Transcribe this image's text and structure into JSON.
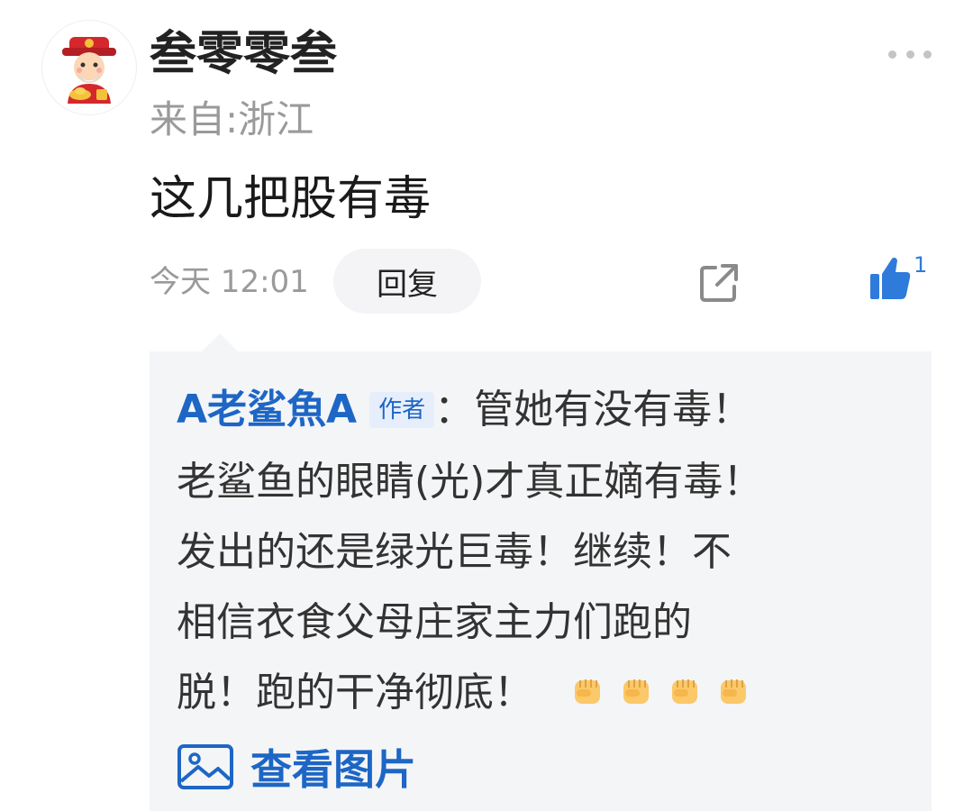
{
  "comment": {
    "username": "叁零零叁",
    "location": "来自:浙江",
    "text": "这几把股有毒",
    "time": "今天 12:01",
    "reply_label": "回复",
    "like_count": "1",
    "icons": {
      "avatar": "god-of-wealth-avatar",
      "more": "more-dots-icon",
      "share": "share-external-icon",
      "like": "thumbs-up-icon"
    }
  },
  "reply": {
    "author": "A老鲨魚A",
    "author_badge": "作者",
    "line1_text": "：管她有没有毒！",
    "line2": "老鲨鱼的眼睛(光)才真正嫡有毒！",
    "line3": "发出的还是绿光巨毒！继续！不",
    "line4": "相信衣食父母庄家主力们跑的",
    "line5": "脱！跑的干净彻底！",
    "emoji_icons": [
      "raised-fist-emoji",
      "raised-fist-emoji",
      "raised-fist-emoji",
      "raised-fist-emoji"
    ],
    "view_image_label": "查看图片",
    "view_image_icon": "image-icon"
  },
  "colors": {
    "link_blue": "#1d66c5",
    "like_blue": "#2e7bdc",
    "muted_gray": "#9a9a9a",
    "reply_bg": "#f4f5f7"
  }
}
